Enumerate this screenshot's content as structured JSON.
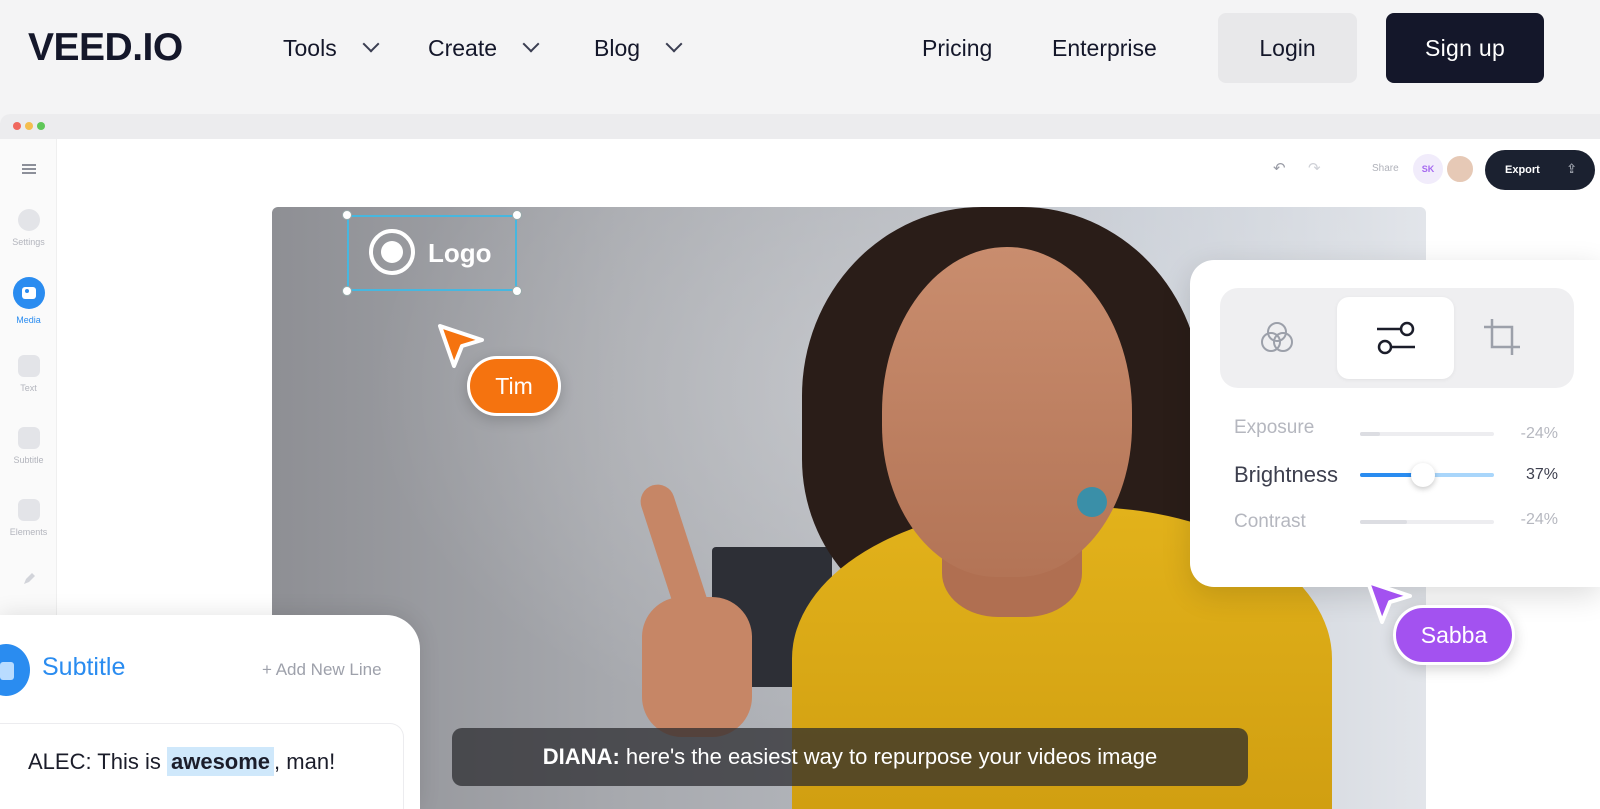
{
  "nav": {
    "brand": "VEED.IO",
    "items": [
      {
        "label": "Tools"
      },
      {
        "label": "Create"
      },
      {
        "label": "Blog"
      }
    ],
    "pricing": "Pricing",
    "enterprise": "Enterprise",
    "login": "Login",
    "signup": "Sign up"
  },
  "editor": {
    "sidebar": [
      {
        "label": "Settings"
      },
      {
        "label": "Media"
      },
      {
        "label": "Text"
      },
      {
        "label": "Subtitle"
      },
      {
        "label": "Elements"
      }
    ],
    "share": "Share",
    "avatar_initials": "SK",
    "export": "Export",
    "logo_text": "Logo",
    "cursor_tim": "Tim",
    "cursor_sabba": "Sabba",
    "adjust": {
      "rows": [
        {
          "label": "Exposure",
          "value": "-24%"
        },
        {
          "label": "Brightness",
          "value": "37%"
        },
        {
          "label": "Contrast",
          "value": "-24%"
        }
      ]
    },
    "subtitles": {
      "title": "Subtitle",
      "add_line": "+ Add New Line",
      "line_prefix": "ALEC: This is ",
      "line_highlight": "awesome",
      "line_suffix": ", man!"
    },
    "caption": {
      "speaker": "DIANA:",
      "text": " here's the easiest way to repurpose your videos image"
    }
  },
  "colors": {
    "accent_blue": "#2a8cf0",
    "tim_orange": "#f5730f",
    "sabba_purple": "#a352f0",
    "dark": "#14172a"
  }
}
